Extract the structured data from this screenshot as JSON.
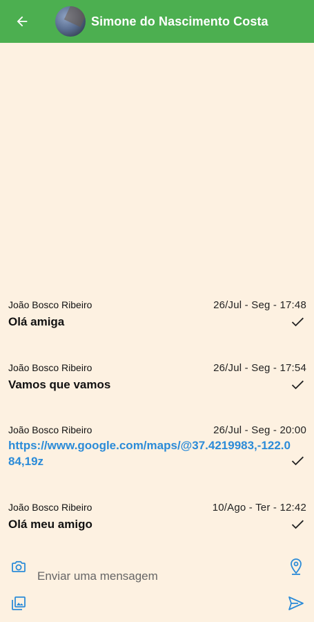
{
  "header": {
    "title": "Simone do Nascimento Costa"
  },
  "messages": [
    {
      "sender": "João Bosco Ribeiro",
      "time": "26/Jul - Seg - 17:48",
      "text": "Olá amiga"
    },
    {
      "sender": "João Bosco Ribeiro",
      "time": "26/Jul - Seg - 17:54",
      "text": "Vamos que vamos"
    },
    {
      "sender": "João Bosco Ribeiro",
      "time": "26/Jul - Seg - 20:00",
      "text": "https://www.google.com/maps/@37.4219983,-122.084,19z"
    },
    {
      "sender": "João Bosco Ribeiro",
      "time": "10/Ago - Ter - 12:42",
      "text": "Olá meu amigo"
    }
  ],
  "composer": {
    "placeholder": "Enviar uma mensagem"
  },
  "colors": {
    "appbar": "#4caf50",
    "background": "#fdf1e1",
    "accent": "#2b8bd8"
  },
  "icons": {
    "back": "arrow-left-icon",
    "camera": "camera-icon",
    "gallery": "gallery-icon",
    "location": "location-pin-icon",
    "send": "send-icon",
    "read": "check-icon"
  }
}
